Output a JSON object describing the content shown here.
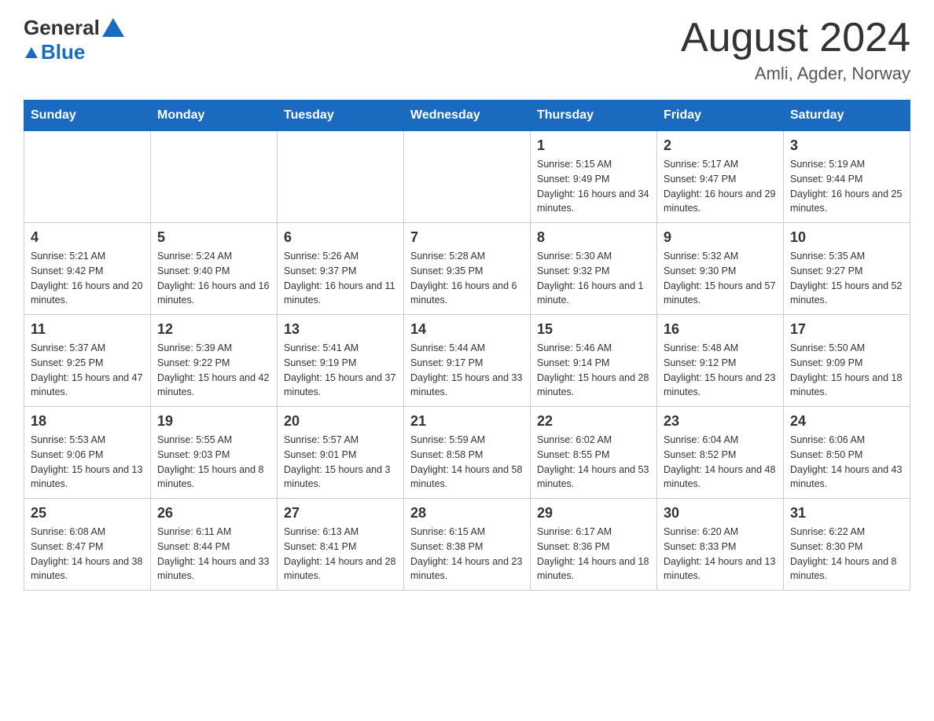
{
  "header": {
    "logo_general": "General",
    "logo_blue": "Blue",
    "title": "August 2024",
    "location": "Amli, Agder, Norway"
  },
  "days_of_week": [
    "Sunday",
    "Monday",
    "Tuesday",
    "Wednesday",
    "Thursday",
    "Friday",
    "Saturday"
  ],
  "weeks": [
    [
      {
        "day": "",
        "info": ""
      },
      {
        "day": "",
        "info": ""
      },
      {
        "day": "",
        "info": ""
      },
      {
        "day": "",
        "info": ""
      },
      {
        "day": "1",
        "info": "Sunrise: 5:15 AM\nSunset: 9:49 PM\nDaylight: 16 hours and 34 minutes."
      },
      {
        "day": "2",
        "info": "Sunrise: 5:17 AM\nSunset: 9:47 PM\nDaylight: 16 hours and 29 minutes."
      },
      {
        "day": "3",
        "info": "Sunrise: 5:19 AM\nSunset: 9:44 PM\nDaylight: 16 hours and 25 minutes."
      }
    ],
    [
      {
        "day": "4",
        "info": "Sunrise: 5:21 AM\nSunset: 9:42 PM\nDaylight: 16 hours and 20 minutes."
      },
      {
        "day": "5",
        "info": "Sunrise: 5:24 AM\nSunset: 9:40 PM\nDaylight: 16 hours and 16 minutes."
      },
      {
        "day": "6",
        "info": "Sunrise: 5:26 AM\nSunset: 9:37 PM\nDaylight: 16 hours and 11 minutes."
      },
      {
        "day": "7",
        "info": "Sunrise: 5:28 AM\nSunset: 9:35 PM\nDaylight: 16 hours and 6 minutes."
      },
      {
        "day": "8",
        "info": "Sunrise: 5:30 AM\nSunset: 9:32 PM\nDaylight: 16 hours and 1 minute."
      },
      {
        "day": "9",
        "info": "Sunrise: 5:32 AM\nSunset: 9:30 PM\nDaylight: 15 hours and 57 minutes."
      },
      {
        "day": "10",
        "info": "Sunrise: 5:35 AM\nSunset: 9:27 PM\nDaylight: 15 hours and 52 minutes."
      }
    ],
    [
      {
        "day": "11",
        "info": "Sunrise: 5:37 AM\nSunset: 9:25 PM\nDaylight: 15 hours and 47 minutes."
      },
      {
        "day": "12",
        "info": "Sunrise: 5:39 AM\nSunset: 9:22 PM\nDaylight: 15 hours and 42 minutes."
      },
      {
        "day": "13",
        "info": "Sunrise: 5:41 AM\nSunset: 9:19 PM\nDaylight: 15 hours and 37 minutes."
      },
      {
        "day": "14",
        "info": "Sunrise: 5:44 AM\nSunset: 9:17 PM\nDaylight: 15 hours and 33 minutes."
      },
      {
        "day": "15",
        "info": "Sunrise: 5:46 AM\nSunset: 9:14 PM\nDaylight: 15 hours and 28 minutes."
      },
      {
        "day": "16",
        "info": "Sunrise: 5:48 AM\nSunset: 9:12 PM\nDaylight: 15 hours and 23 minutes."
      },
      {
        "day": "17",
        "info": "Sunrise: 5:50 AM\nSunset: 9:09 PM\nDaylight: 15 hours and 18 minutes."
      }
    ],
    [
      {
        "day": "18",
        "info": "Sunrise: 5:53 AM\nSunset: 9:06 PM\nDaylight: 15 hours and 13 minutes."
      },
      {
        "day": "19",
        "info": "Sunrise: 5:55 AM\nSunset: 9:03 PM\nDaylight: 15 hours and 8 minutes."
      },
      {
        "day": "20",
        "info": "Sunrise: 5:57 AM\nSunset: 9:01 PM\nDaylight: 15 hours and 3 minutes."
      },
      {
        "day": "21",
        "info": "Sunrise: 5:59 AM\nSunset: 8:58 PM\nDaylight: 14 hours and 58 minutes."
      },
      {
        "day": "22",
        "info": "Sunrise: 6:02 AM\nSunset: 8:55 PM\nDaylight: 14 hours and 53 minutes."
      },
      {
        "day": "23",
        "info": "Sunrise: 6:04 AM\nSunset: 8:52 PM\nDaylight: 14 hours and 48 minutes."
      },
      {
        "day": "24",
        "info": "Sunrise: 6:06 AM\nSunset: 8:50 PM\nDaylight: 14 hours and 43 minutes."
      }
    ],
    [
      {
        "day": "25",
        "info": "Sunrise: 6:08 AM\nSunset: 8:47 PM\nDaylight: 14 hours and 38 minutes."
      },
      {
        "day": "26",
        "info": "Sunrise: 6:11 AM\nSunset: 8:44 PM\nDaylight: 14 hours and 33 minutes."
      },
      {
        "day": "27",
        "info": "Sunrise: 6:13 AM\nSunset: 8:41 PM\nDaylight: 14 hours and 28 minutes."
      },
      {
        "day": "28",
        "info": "Sunrise: 6:15 AM\nSunset: 8:38 PM\nDaylight: 14 hours and 23 minutes."
      },
      {
        "day": "29",
        "info": "Sunrise: 6:17 AM\nSunset: 8:36 PM\nDaylight: 14 hours and 18 minutes."
      },
      {
        "day": "30",
        "info": "Sunrise: 6:20 AM\nSunset: 8:33 PM\nDaylight: 14 hours and 13 minutes."
      },
      {
        "day": "31",
        "info": "Sunrise: 6:22 AM\nSunset: 8:30 PM\nDaylight: 14 hours and 8 minutes."
      }
    ]
  ]
}
